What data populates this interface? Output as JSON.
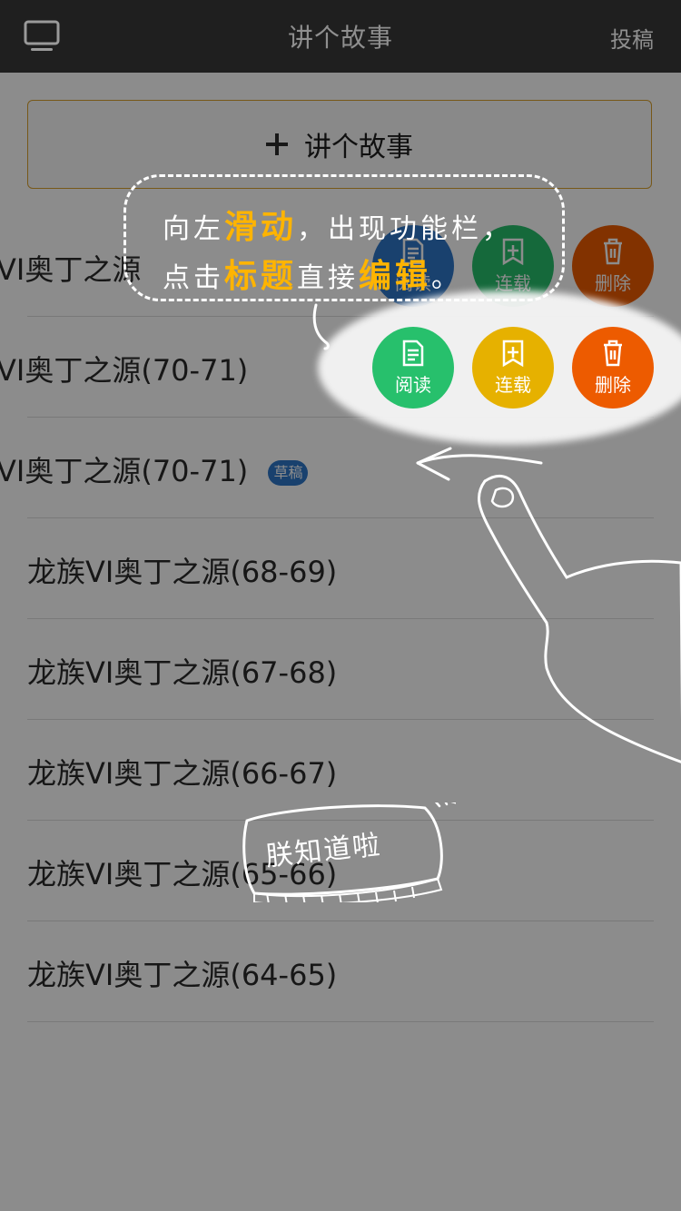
{
  "header": {
    "title": "讲个故事",
    "submit": "投稿"
  },
  "compose": {
    "label": "讲个故事"
  },
  "list": [
    {
      "text": "VI奥丁之源",
      "badge": ""
    },
    {
      "text": "VI奥丁之源(70-71)",
      "badge": ""
    },
    {
      "text": "VI奥丁之源(70-71)",
      "badge": "草稿"
    },
    {
      "text": "龙族VI奥丁之源(68-69)",
      "badge": ""
    },
    {
      "text": "龙族VI奥丁之源(67-68)",
      "badge": ""
    },
    {
      "text": "龙族VI奥丁之源(66-67)",
      "badge": ""
    },
    {
      "text": "龙族VI奥丁之源(65-66)",
      "badge": ""
    },
    {
      "text": "龙族VI奥丁之源(64-65)",
      "badge": ""
    }
  ],
  "actions": {
    "read": "阅读",
    "serial": "连载",
    "delete": "删除"
  },
  "tip": {
    "line1_a": "向左",
    "line1_hl": "滑动",
    "line1_b": "，出现功能栏，",
    "line2_a": "点击",
    "line2_hl1": "标题",
    "line2_mid": "直接",
    "line2_hl2": "编辑",
    "line2_end": "。"
  },
  "ok_button": "朕知道啦",
  "colors": {
    "accent": "#ffb400",
    "green": "#27c06c",
    "yellow": "#e6b100",
    "orange": "#ed5b00"
  }
}
